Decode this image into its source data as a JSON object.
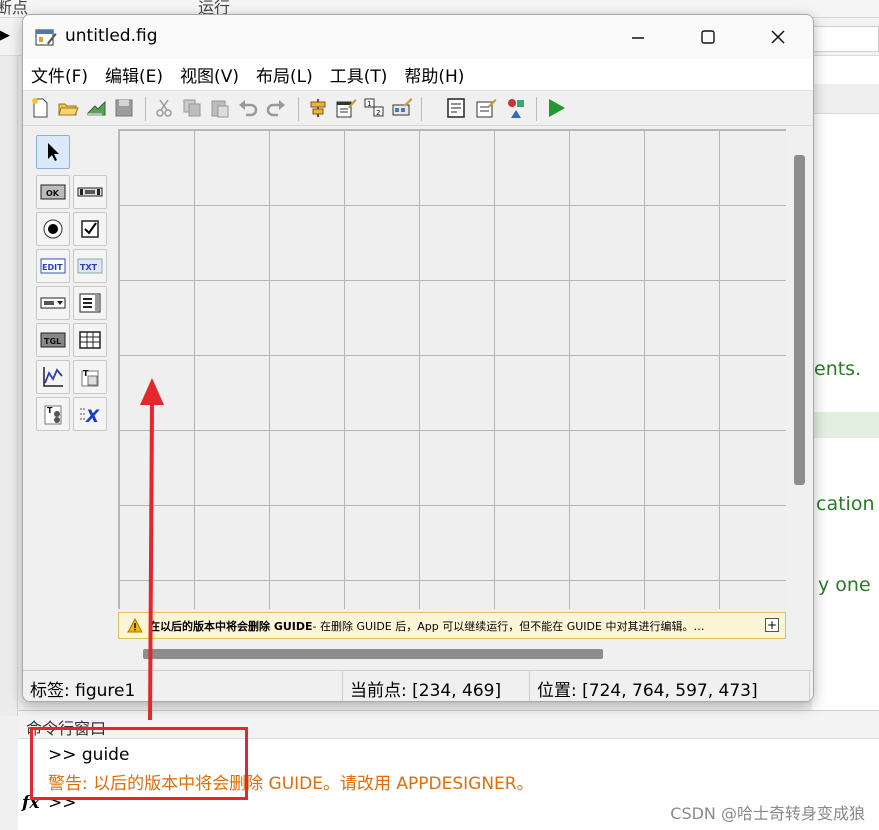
{
  "background": {
    "top_text_left": "断点",
    "top_text_mid": "运行",
    "right_texts": [
      "ents.",
      "cation",
      "y one"
    ],
    "command_window": {
      "title": "命令行窗口",
      "prompt_line": ">> guide",
      "warning_line": "警告: 以后的版本中将会删除 GUIDE。请改用 APPDESIGNER。",
      "empty_prompt": ">>",
      "fx_label": "fx"
    },
    "watermark": "CSDN @哈士奇转身变成狼"
  },
  "window": {
    "title": "untitled.fig",
    "controls": {
      "minimize": "—",
      "maximize": "☐",
      "close": "✕"
    },
    "menu": [
      "文件(F)",
      "编辑(E)",
      "视图(V)",
      "布局(L)",
      "工具(T)",
      "帮助(H)"
    ],
    "toolbar_icons": [
      "new-file-icon",
      "open-folder-icon",
      "save-as-icon",
      "save-icon",
      "cut-icon",
      "copy-icon",
      "paste-icon",
      "undo-icon",
      "redo-icon",
      "align-icon",
      "menu-editor-icon",
      "tab-order-icon",
      "toolbar-editor-icon",
      "editor-icon",
      "property-inspector-icon",
      "object-browser-icon",
      "run-icon"
    ],
    "palette": [
      {
        "name": "select-tool",
        "label": ""
      },
      {
        "name": "pushbutton-tool",
        "label": "OK"
      },
      {
        "name": "slider-tool",
        "label": ""
      },
      {
        "name": "radiobutton-tool",
        "label": ""
      },
      {
        "name": "checkbox-tool",
        "label": ""
      },
      {
        "name": "edit-text-tool",
        "label": "EDIT"
      },
      {
        "name": "static-text-tool",
        "label": "TXT"
      },
      {
        "name": "popup-menu-tool",
        "label": ""
      },
      {
        "name": "listbox-tool",
        "label": ""
      },
      {
        "name": "toggle-button-tool",
        "label": "TGL"
      },
      {
        "name": "table-tool",
        "label": ""
      },
      {
        "name": "axes-tool",
        "label": ""
      },
      {
        "name": "panel-tool",
        "label": "T"
      },
      {
        "name": "button-group-tool",
        "label": "T"
      },
      {
        "name": "activex-tool",
        "label": "X"
      }
    ],
    "warning_bar": {
      "bold": "在以后的版本中将会删除 GUIDE",
      "rest": " - 在删除 GUIDE 后，App 可以继续运行，但不能在 GUIDE 中对其进行编辑。…",
      "expand": "+"
    },
    "status": {
      "tag": "标签: figure1",
      "current_point": "当前点:  [234, 469]",
      "position": "位置: [724, 764, 597, 473]"
    }
  },
  "colors": {
    "warning_text": "#e36c09",
    "annotation_red": "#e5262c",
    "run_green": "#1f9a2e"
  }
}
